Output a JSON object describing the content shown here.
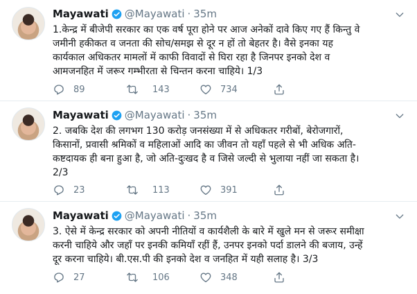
{
  "tweets": [
    {
      "name": "Mayawati",
      "handle": "@Mayawati",
      "separator": "·",
      "time": "35m",
      "text": "1.केन्द्र में बीजेपी सरकार का एक वर्ष पूरा होने पर आज अनेकों दावे किए गए हैं किन्तु वे\nजमीनी हकीकत व जनता की सोच/समझ से दूर न हों तो बेहतर है। वैसे इनका यह\nकार्यकाल अधिकतर मामलों में काफी विवादों से घिरा रहा है जिनपर इनको देश व\nआमजनहित में जरूर गम्भीरता से चिन्तन करना चाहिये। 1/3",
      "replies": "89",
      "retweets": "143",
      "likes": "734"
    },
    {
      "name": "Mayawati",
      "handle": "@Mayawati",
      "separator": "·",
      "time": "35m",
      "text": "2. जबकि देश की लगभग 130 करोड़ जनसंख्या में से अधिकतर गरीबों, बेरोजगारों,\nकिसानों, प्रवासी श्रमिकों व महिलाओं आदि का जीवन तो यहाँ पहले से भी अधिक अति-\nकष्टदायक ही बना हुआ है, जो अति-दुःखद है व जिसे जल्दी से भुलाया नहीं जा सकता है।\n2/3",
      "replies": "23",
      "retweets": "113",
      "likes": "391"
    },
    {
      "name": "Mayawati",
      "handle": "@Mayawati",
      "separator": "·",
      "time": "35m",
      "text": "3. ऐसे में केन्द्र सरकार को अपनी नीतियों व कार्यशैली के बारे में खुले मन से जरूर समीक्षा\nकरनी चाहिये और जहाँ पर इनकी कमियाँ रहीं हैं, उनपर इनको पर्दा डालने की बजाय, उन्हें\nदूर करना चाहिये। बी.एस.पी की इनको देश व जनहित में यही सलाह है। 3/3",
      "replies": "27",
      "retweets": "106",
      "likes": "348"
    }
  ],
  "colors": {
    "verified": "#1da1f2",
    "muted": "#657786",
    "text": "#14171a",
    "divider": "#e6ecf0"
  },
  "icons": [
    "verified-badge-icon",
    "chevron-down-icon",
    "reply-icon",
    "retweet-icon",
    "like-icon",
    "share-icon"
  ]
}
